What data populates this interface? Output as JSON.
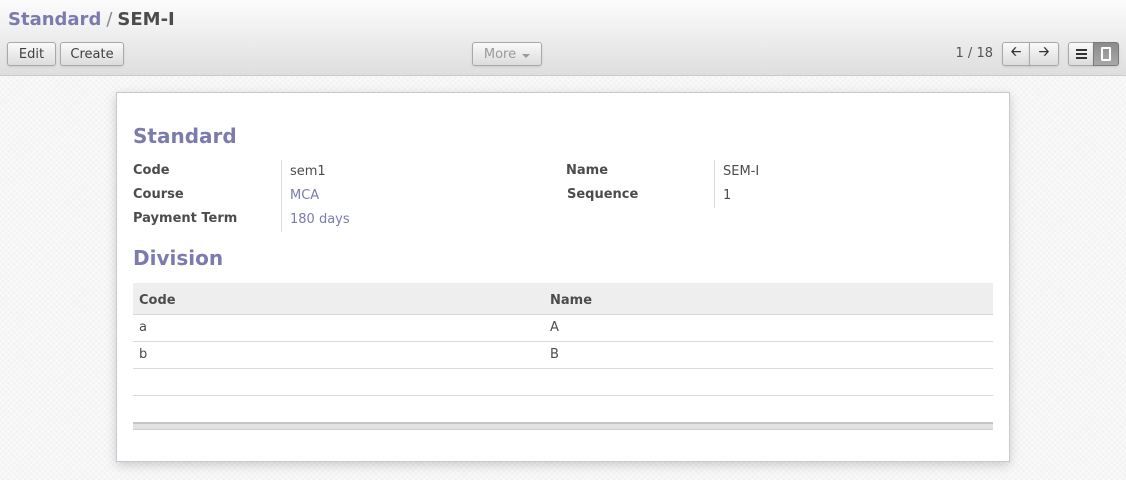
{
  "breadcrumb": {
    "parent": "Standard",
    "separator": "/",
    "current": "SEM-I"
  },
  "toolbar": {
    "edit_label": "Edit",
    "create_label": "Create",
    "more_label": "More"
  },
  "pager": {
    "value": "1 / 18"
  },
  "view_switcher": {
    "list_icon": "list-view-icon",
    "form_icon": "form-view-icon",
    "active": "form"
  },
  "form": {
    "section_title": "Standard",
    "fields": {
      "code_label": "Code",
      "code_value": "sem1",
      "course_label": "Course",
      "course_value": "MCA",
      "payment_term_label": "Payment Term",
      "payment_term_value": "180 days",
      "name_label": "Name",
      "name_value": "SEM-I",
      "sequence_label": "Sequence",
      "sequence_value": "1"
    },
    "division": {
      "title": "Division",
      "columns": [
        "Code",
        "Name"
      ],
      "rows": [
        [
          "a",
          "A"
        ],
        [
          "b",
          "B"
        ]
      ]
    }
  },
  "colors": {
    "accent": "#7c7bad",
    "text": "#4c4c4c"
  }
}
